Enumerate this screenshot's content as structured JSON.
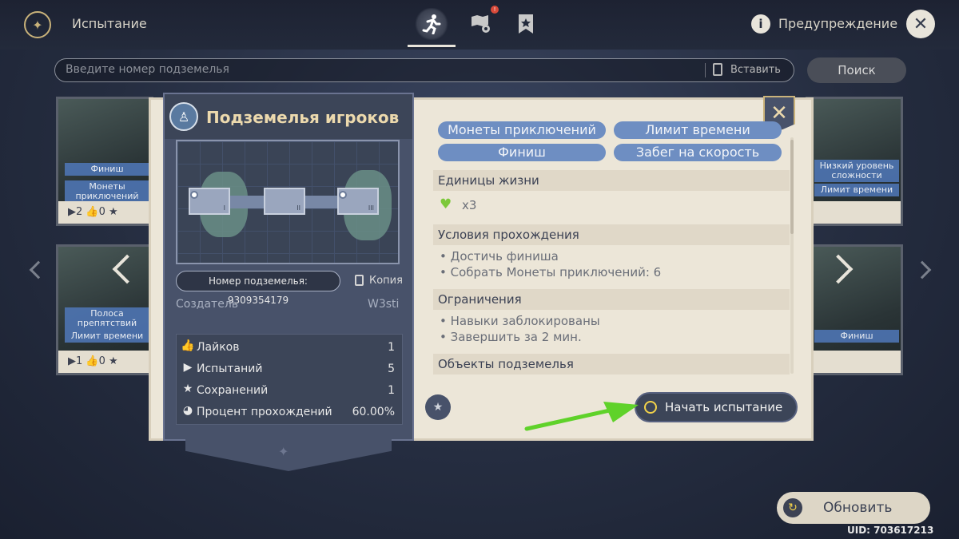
{
  "header": {
    "title": "Испытание",
    "warning_label": "Предупреждение",
    "tab_badge": "!"
  },
  "search": {
    "placeholder": "Введите номер подземелья",
    "paste_label": "Вставить",
    "search_button": "Поиск"
  },
  "background_cards": [
    {
      "chips": [
        "Финиш",
        "Монеты приключений"
      ],
      "stats": "▶2  👍0  ★"
    },
    {
      "chips": [
        "Полоса препятствий",
        "Лимит времени"
      ],
      "stats": "▶1  👍0  ★"
    },
    {
      "chips": [
        "Низкий уровень сложности",
        "Лимит времени"
      ],
      "stats": ""
    },
    {
      "chips": [
        "Финиш"
      ],
      "stats": ""
    }
  ],
  "left_panel": {
    "title": "Подземелья игроков",
    "dungeon_id_label": "Номер подземелья: 9309354179",
    "copy_label": "Копия",
    "creator_label": "Создатель",
    "creator_name": "W3sti",
    "rooms": [
      "I",
      "II",
      "III"
    ],
    "stats": [
      {
        "label": "Лайков",
        "value": "1",
        "icon": "thumbs-up-icon"
      },
      {
        "label": "Испытаний",
        "value": "5",
        "icon": "play-icon"
      },
      {
        "label": "Сохранений",
        "value": "1",
        "icon": "star-icon"
      },
      {
        "label": "Процент прохождений",
        "value": "60.00%",
        "icon": "pie-icon"
      }
    ]
  },
  "right_panel": {
    "tags": [
      "Монеты приключений",
      "Лимит времени",
      "Финиш",
      "Забег на скорость"
    ],
    "lives": {
      "heading": "Единицы жизни",
      "count": "x3"
    },
    "conditions": {
      "heading": "Условия прохождения",
      "items": [
        "• Достичь финиша",
        "• Собрать Монеты приключений: 6"
      ]
    },
    "restrictions": {
      "heading": "Ограничения",
      "items": [
        "• Навыки заблокированы",
        "• Завершить за 2 мин."
      ]
    },
    "objects": {
      "heading": "Объекты подземелья"
    },
    "start_button": "Начать испытание"
  },
  "footer": {
    "refresh_button": "Обновить",
    "uid": "UID: 703617213"
  },
  "colors": {
    "accent_gold": "#ecd9ad",
    "tag_blue": "#6e8ec2",
    "heart_green": "#7cc83a",
    "pointer_arrow_green": "#5fd22a"
  }
}
